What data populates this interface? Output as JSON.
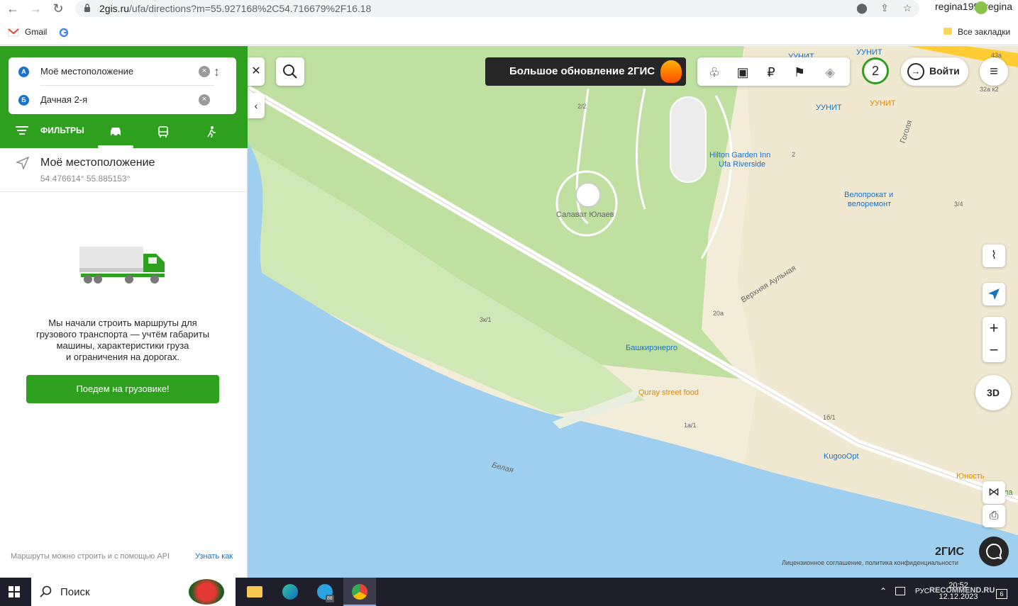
{
  "browser": {
    "url_host": "2gis.ru",
    "url_path": "/ufa/directions?m=55.927168%2C54.716679%2F16.18",
    "profile_name": "regina1992regina",
    "bookmarks": {
      "gmail": "Gmail",
      "all_bookmarks": "Все закладки"
    }
  },
  "panel": {
    "point_a_badge": "А",
    "point_a_text": "Моё местоположение",
    "point_b_badge": "Б",
    "point_b_text": "Дачная 2-я",
    "filters_label": "ФИЛЬТРЫ",
    "location_title": "Моё местоположение",
    "location_coords": "54.476614° 55.885153°",
    "info_line1": "Мы начали строить маршруты для",
    "info_line2": "грузового транспорта — учтём габариты",
    "info_line3": "машины, характеристики груза",
    "info_line4": "и ограничения на дорогах.",
    "truck_button": "Поедем на грузовике!",
    "api_note": "Маршруты можно строить и с помощью API",
    "api_link": "Узнать как"
  },
  "map": {
    "banner_text": "Большое обновление 2ГИС",
    "counter": "2",
    "login_label": "Войти",
    "zoom_in": "+",
    "zoom_out": "−",
    "view_3d": "3D",
    "logo": "2ГИС",
    "license": "Лицензионное соглашение, политика конфиденциальности",
    "labels": {
      "salavat": "Салават Юлаев",
      "hilton1": "Hilton Garden Inn",
      "hilton2": "Ufa Riverside",
      "velo1": "Велопрокат и",
      "velo2": "велоремонт",
      "bashkir": "Башкирэнерго",
      "quray": "Quray street food",
      "kugoo": "KugooOpt",
      "yunost": "Юность",
      "belaya": "Белая",
      "verkhnyaya": "Верхняя Аульная",
      "gogolya": "Гоголя",
      "uunit1": "УУНИТ",
      "uunit2": "УУНИТ",
      "uunit3": "УУНИТ",
      "uunit4": "УУНИТ",
      "n22": "2/2",
      "n3k1": "3к/1",
      "n1a1": "1а/1",
      "n1b1": "1б/1",
      "n20a": "20а",
      "n34": "3/4",
      "n2": "2",
      "n32ak2": "32а к2",
      "n43a": "43а",
      "la": "ла"
    }
  },
  "taskbar": {
    "search_placeholder": "Поиск",
    "time": "20:52",
    "date": "12.12.2023",
    "lang": "РУС",
    "telegram_badge": "88",
    "notif_count": "6",
    "watermark": "RECOMMEND.RU"
  }
}
